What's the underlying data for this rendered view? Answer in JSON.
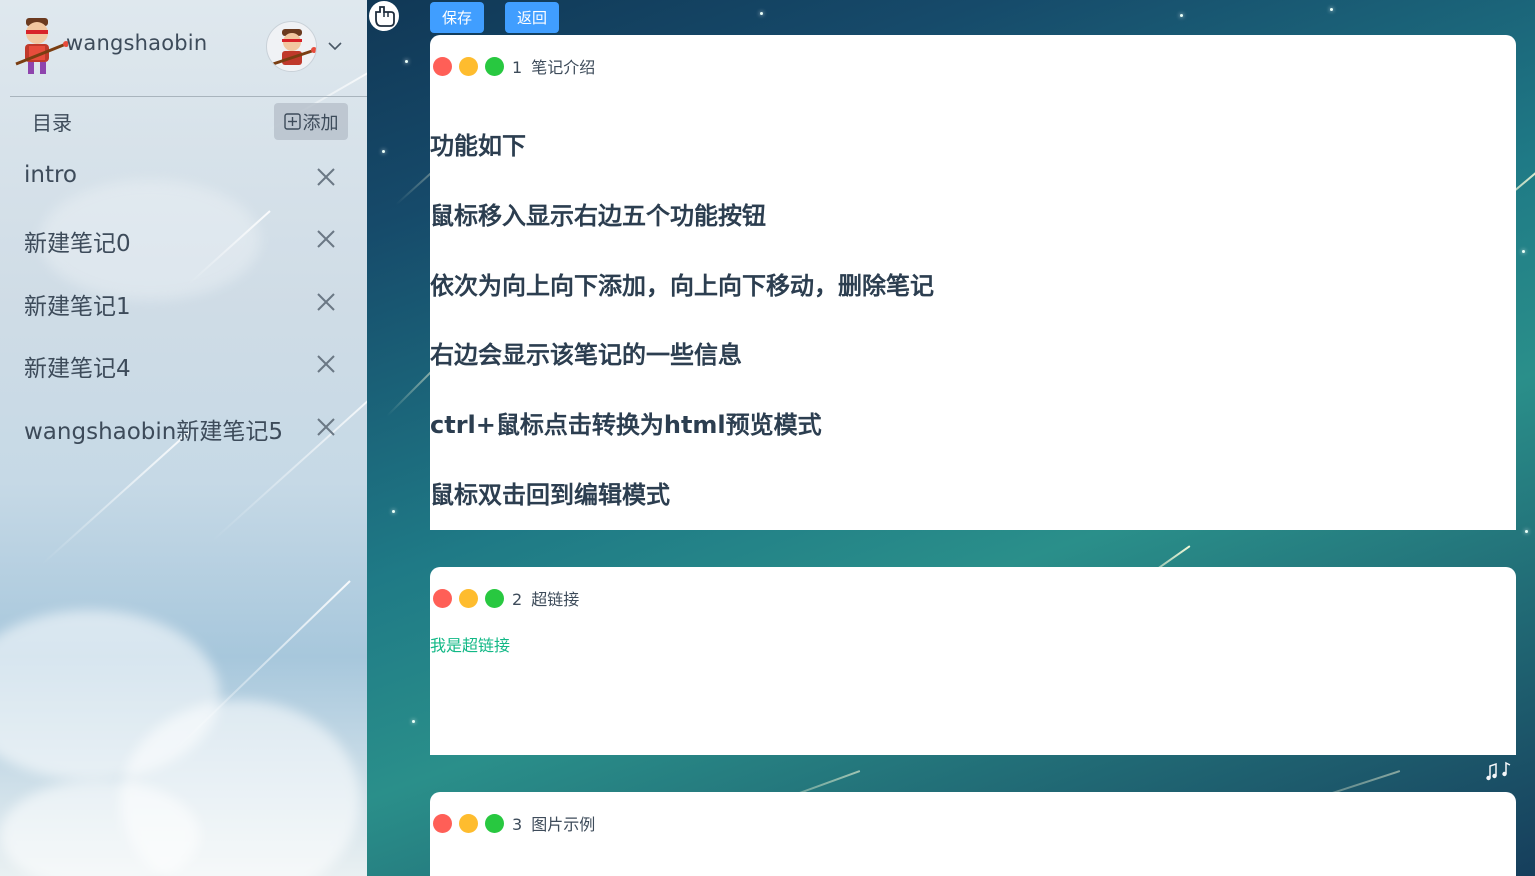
{
  "user": {
    "name": "wangshaobin"
  },
  "sidebar": {
    "toc_label": "目录",
    "add_label": "添加",
    "notes": [
      {
        "label": "intro"
      },
      {
        "label": "新建笔记0"
      },
      {
        "label": "新建笔记1"
      },
      {
        "label": "新建笔记4"
      },
      {
        "label": "wangshaobin新建笔记5"
      }
    ]
  },
  "toolbar": {
    "save_label": "保存",
    "back_label": "返回"
  },
  "cards": [
    {
      "number": "1",
      "title": "笔记介绍",
      "lines": [
        "功能如下",
        "鼠标移入显示右边五个功能按钮",
        "依次为向上向下添加，向上向下移动，删除笔记",
        "右边会显示该笔记的一些信息",
        "ctrl+鼠标点击转换为html预览模式",
        "鼠标双击回到编辑模式"
      ]
    },
    {
      "number": "2",
      "title": "超链接",
      "link_text": "我是超链接"
    },
    {
      "number": "3",
      "title": "图片示例"
    }
  ],
  "colors": {
    "primary": "#409eff",
    "link": "#12b886",
    "dot_red": "#ff5f57",
    "dot_yellow": "#febc2e",
    "dot_green": "#28c840"
  },
  "icons": [
    "avatar",
    "chevron-down-icon",
    "plus-square-icon",
    "close-icon",
    "hand-cursor-icon",
    "music-note-icon"
  ]
}
